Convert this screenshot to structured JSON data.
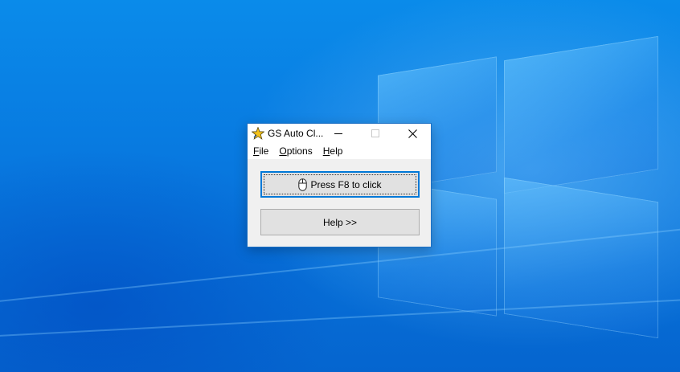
{
  "window": {
    "title": "GS Auto Cl...",
    "controls": {
      "minimize": "minimize-icon",
      "maximize": "maximize-icon",
      "close": "close-icon"
    }
  },
  "menu": {
    "items": [
      {
        "label": "File"
      },
      {
        "label": "Options"
      },
      {
        "label": "Help"
      }
    ]
  },
  "main": {
    "click_button_label": "Press F8 to click",
    "click_button_icon": "mouse-icon",
    "help_button_label": "Help >>"
  },
  "colors": {
    "accent": "#0078d7",
    "button_face": "#e1e1e1",
    "window_bg": "#f0f0f0"
  }
}
